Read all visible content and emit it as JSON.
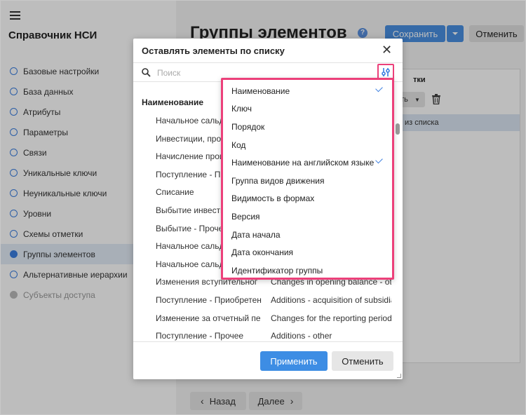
{
  "app": {
    "title": "Справочник НСИ"
  },
  "sidebar": {
    "items": [
      {
        "label": "Базовые настройки",
        "state": "normal"
      },
      {
        "label": "База данных",
        "state": "normal"
      },
      {
        "label": "Атрибуты",
        "state": "normal"
      },
      {
        "label": "Параметры",
        "state": "normal"
      },
      {
        "label": "Связи",
        "state": "normal"
      },
      {
        "label": "Уникальные ключи",
        "state": "normal"
      },
      {
        "label": "Неуникальные ключи",
        "state": "normal"
      },
      {
        "label": "Уровни",
        "state": "normal"
      },
      {
        "label": "Схемы отметки",
        "state": "normal"
      },
      {
        "label": "Группы элементов",
        "state": "active"
      },
      {
        "label": "Альтернативные иерархии",
        "state": "normal"
      },
      {
        "label": "Субъекты доступа",
        "state": "disabled"
      }
    ]
  },
  "main": {
    "title": "Группы элементов",
    "help": "?",
    "save_label": "Сохранить",
    "cancel_label": "Отменить",
    "panel_header": "тки",
    "panel_dropdown": "ить",
    "panel_row": "из списка",
    "back_label": "Назад",
    "next_label": "Далее"
  },
  "modal": {
    "title": "Оставлять элементы по списку",
    "search_placeholder": "Поиск",
    "column_header": "Наименование",
    "items": [
      {
        "ru": "Начальное сальд",
        "en": ""
      },
      {
        "ru": "Инвестиции, прои",
        "en": ""
      },
      {
        "ru": "Начисление проце",
        "en": ""
      },
      {
        "ru": "Поступление - Пр",
        "en": ""
      },
      {
        "ru": "Списание",
        "en": ""
      },
      {
        "ru": "Выбытие инвести",
        "en": ""
      },
      {
        "ru": "Выбытие - Прочее",
        "en": ""
      },
      {
        "ru": "Начальное сальд",
        "en": ""
      },
      {
        "ru": "Начальное сальд",
        "en": ""
      },
      {
        "ru": "Изменения вступительног",
        "en": "Changes in opening balance - othe"
      },
      {
        "ru": "Поступление - Приобретен",
        "en": "Additions - acquisition of subsidiar"
      },
      {
        "ru": "Изменение за отчетный пе",
        "en": "Changes for the reporting period"
      },
      {
        "ru": "Поступление - Прочее",
        "en": "Additions - other"
      }
    ],
    "apply_label": "Применить",
    "cancel_label": "Отменить"
  },
  "columns_menu": {
    "items": [
      {
        "label": "Наименование",
        "checked": true
      },
      {
        "label": "Ключ",
        "checked": false
      },
      {
        "label": "Порядок",
        "checked": false
      },
      {
        "label": "Код",
        "checked": false
      },
      {
        "label": "Наименование на английском языке",
        "checked": true
      },
      {
        "label": "Группа видов движения",
        "checked": false
      },
      {
        "label": "Видимость в формах",
        "checked": false
      },
      {
        "label": "Версия",
        "checked": false
      },
      {
        "label": "Дата начала",
        "checked": false
      },
      {
        "label": "Дата окончания",
        "checked": false
      },
      {
        "label": "Идентификатор группы",
        "checked": false
      }
    ]
  },
  "colors": {
    "accent": "#3a7ee0",
    "highlight": "#ec407a"
  }
}
